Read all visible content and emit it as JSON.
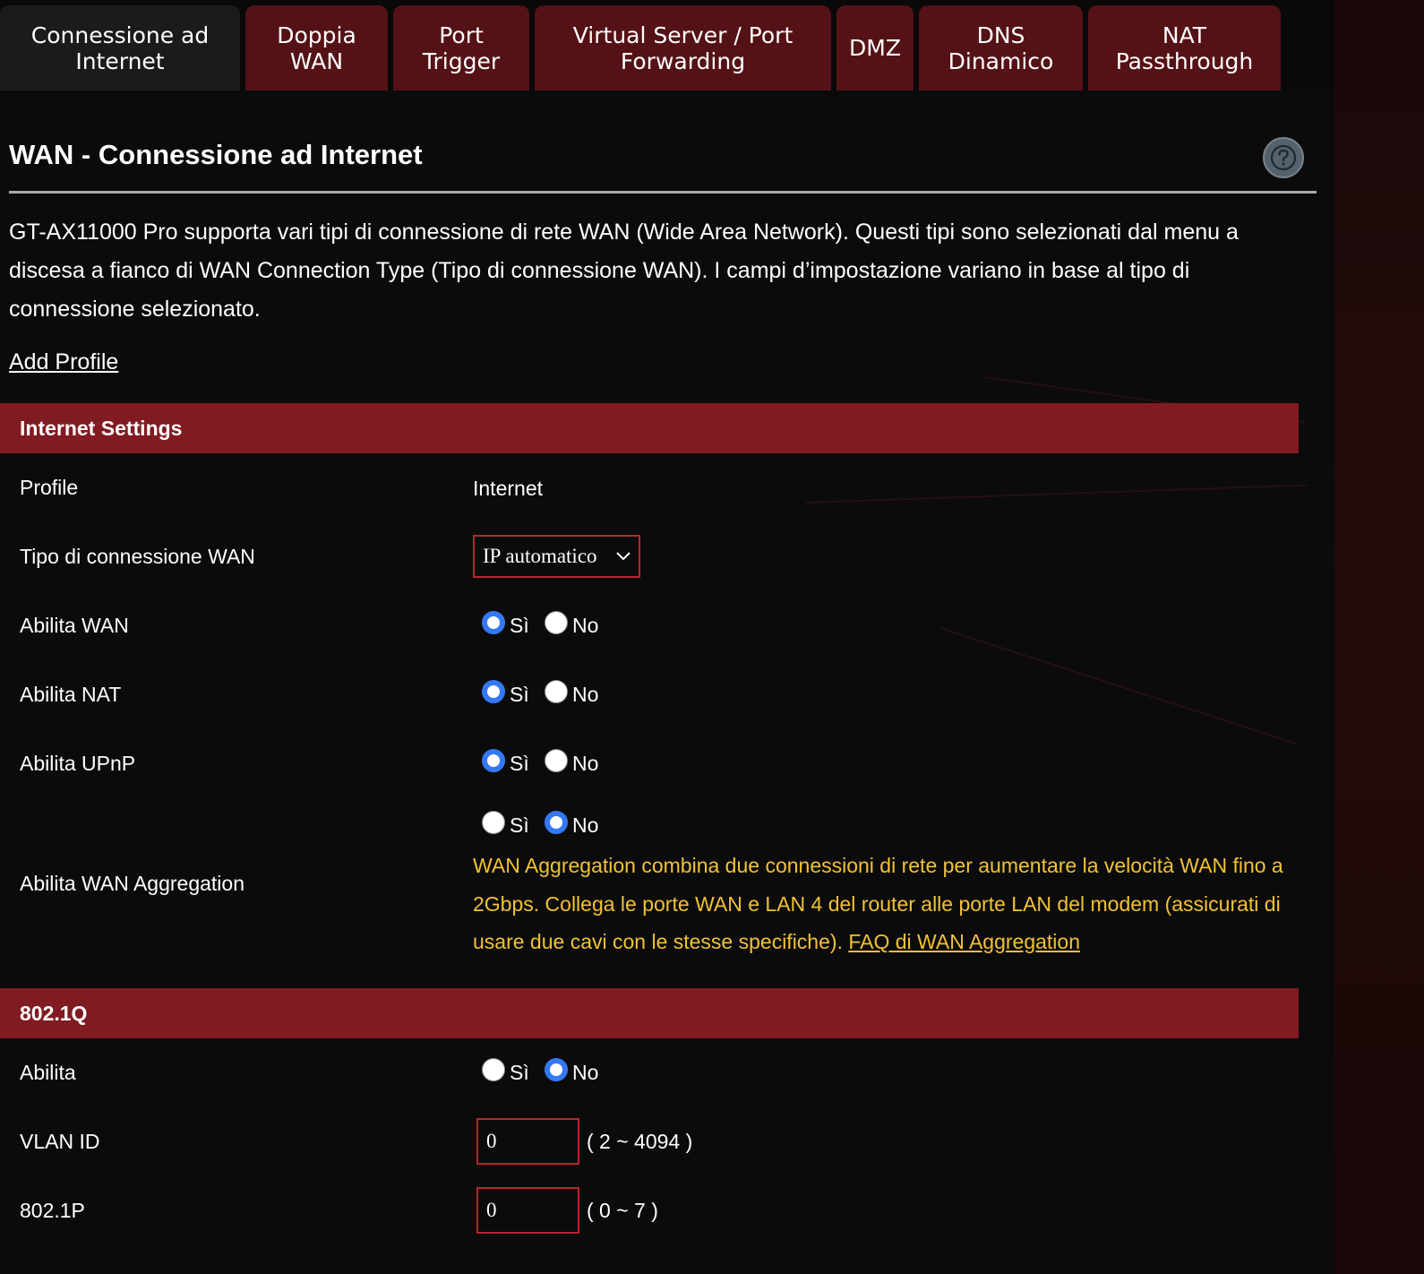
{
  "tabs": [
    {
      "label": "Connessione ad\nInternet",
      "active": true
    },
    {
      "label": "Doppia\nWAN"
    },
    {
      "label": "Port\nTrigger"
    },
    {
      "label": "Virtual Server / Port\nForwarding"
    },
    {
      "label": "DMZ"
    },
    {
      "label": "DNS\nDinamico"
    },
    {
      "label": "NAT\nPassthrough"
    }
  ],
  "page": {
    "title": "WAN - Connessione ad Internet",
    "help_icon": "question-icon",
    "intro": "GT-AX11000 Pro supporta vari tipi di connessione di rete WAN (Wide Area Network). Questi tipi sono selezionati dal menu a discesa a fianco di WAN Connection Type (Tipo di connessione WAN). I campi d’impostazione variano in base al tipo di connessione selezionato.",
    "add_profile": "Add Profile"
  },
  "internet_settings": {
    "header": "Internet Settings",
    "profile_label": "Profile",
    "profile_value": "Internet",
    "wan_type_label": "Tipo di connessione WAN",
    "wan_type_value": "IP automatico",
    "enable_wan": {
      "label": "Abilita WAN",
      "yes": "Sì",
      "no": "No",
      "selected": "yes"
    },
    "enable_nat": {
      "label": "Abilita NAT",
      "yes": "Sì",
      "no": "No",
      "selected": "yes"
    },
    "enable_upnp": {
      "label": "Abilita UPnP",
      "yes": "Sì",
      "no": "No",
      "selected": "yes"
    },
    "wan_aggregation": {
      "label": "Abilita WAN Aggregation",
      "yes": "Sì",
      "no": "No",
      "selected": "no",
      "note": "WAN Aggregation combina due connessioni di rete per aumentare la velocità WAN fino a 2Gbps. Collega le porte WAN e LAN 4 del router alle porte LAN del modem (assicurati di usare due cavi con le stesse specifiche).",
      "faq_link": "FAQ di WAN Aggregation"
    }
  },
  "dot1q": {
    "header": "802.1Q",
    "enable": {
      "label": "Abilita",
      "yes": "Sì",
      "no": "No",
      "selected": "no"
    },
    "vlan_id": {
      "label": "VLAN ID",
      "value": "0",
      "range": "( 2 ~ 4094 )"
    },
    "priority": {
      "label": "802.1P",
      "value": "0",
      "range": "( 0 ~ 7 )"
    }
  },
  "colors": {
    "section_bar": "#801b22",
    "tab_bg": "#551216",
    "note_text": "#f2c233",
    "radio_checked": "#3478f6"
  }
}
